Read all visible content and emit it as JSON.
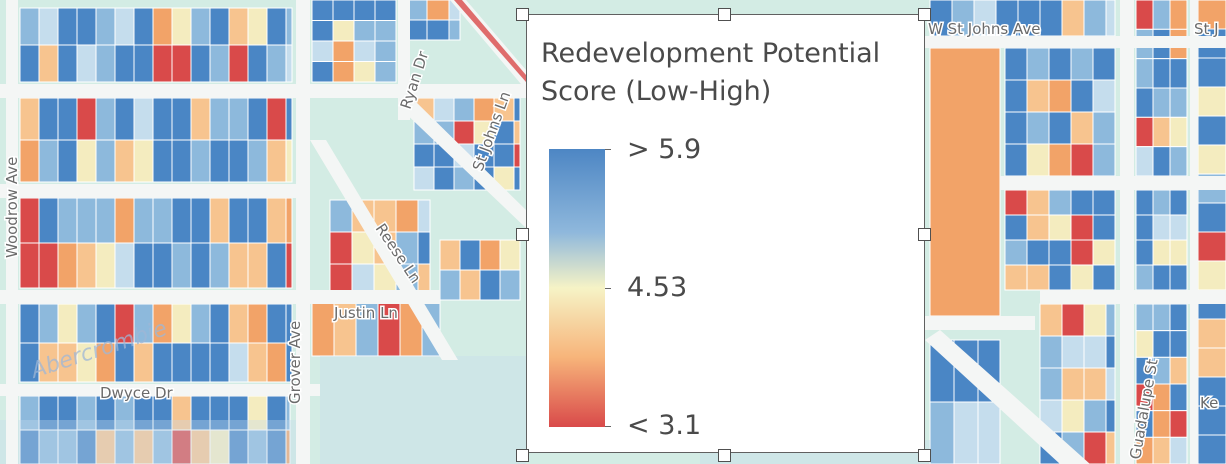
{
  "map": {
    "street_labels": [
      "Woodrow Ave",
      "Ryan Dr",
      "St Johns Ln",
      "Reese Ln",
      "Justin Ln",
      "Abercrombie",
      "Grover Ave",
      "Dwyce Dr",
      "W St Johns Ave",
      "St J",
      "Guadalupe St",
      "Ke"
    ],
    "palette": {
      "blue": "#4a86c5",
      "lightblue": "#8db9dc",
      "paleblue": "#c5dded",
      "cream": "#f4ecbf",
      "orange": "#f7c48f",
      "darkorange": "#f2a368",
      "red": "#d94a4a",
      "base": "#d3ece4",
      "road": "#f4f6f5"
    }
  },
  "legend": {
    "title_line1": "Redevelopment Potential",
    "title_line2": "Score (Low-High)",
    "labels": [
      "> 5.9",
      "4.53",
      "< 3.1"
    ],
    "ramp_colors": [
      "#4d86c4",
      "#8fb8dc",
      "#f6f3c6",
      "#f7b47a",
      "#d94a4a"
    ]
  }
}
